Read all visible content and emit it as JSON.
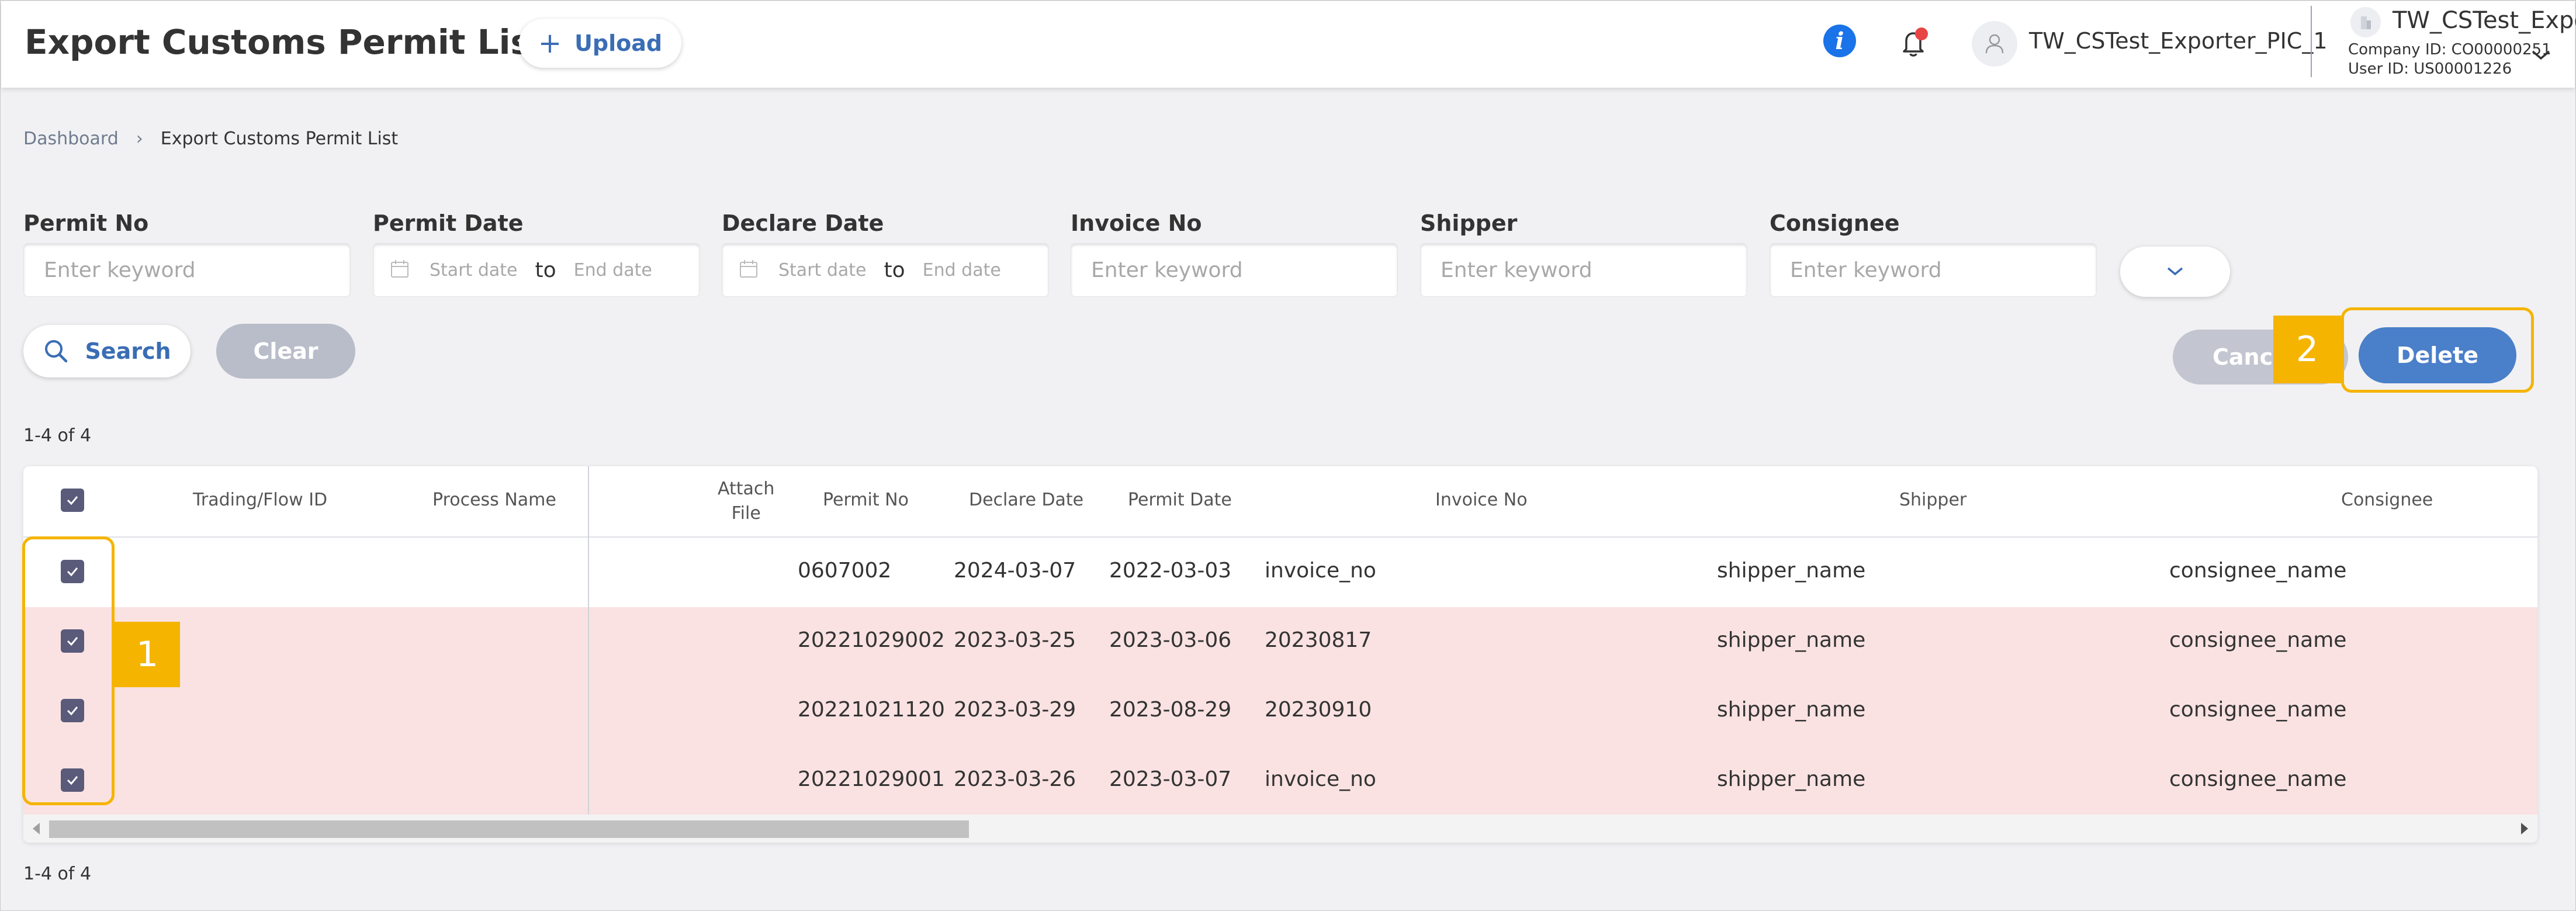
{
  "header": {
    "title": "Export Customs Permit List",
    "upload_label": "Upload",
    "user_name": "TW_CSTest_Exporter_PIC_1",
    "company_name": "TW_CSTest_Expo...",
    "company_id": "Company ID: CO00000251",
    "user_id": "User ID: US00001226"
  },
  "breadcrumb": {
    "home": "Dashboard",
    "separator": "›",
    "current": "Export Customs Permit List"
  },
  "filters": {
    "permit_no": {
      "label": "Permit No",
      "placeholder": "Enter keyword"
    },
    "permit_date": {
      "label": "Permit Date",
      "start": "Start date",
      "to": "to",
      "end": "End date"
    },
    "declare_date": {
      "label": "Declare Date",
      "start": "Start date",
      "to": "to",
      "end": "End date"
    },
    "invoice_no": {
      "label": "Invoice No",
      "placeholder": "Enter keyword"
    },
    "shipper": {
      "label": "Shipper",
      "placeholder": "Enter keyword"
    },
    "consignee": {
      "label": "Consignee",
      "placeholder": "Enter keyword"
    }
  },
  "actions": {
    "search": "Search",
    "clear": "Clear",
    "cancel": "Cancel",
    "delete": "Delete"
  },
  "count_top": "1-4 of 4",
  "count_bottom": "1-4 of 4",
  "table": {
    "headers": {
      "trading_flow_id": "Trading/Flow ID",
      "process_name": "Process Name",
      "attach_file_1": "Attach",
      "attach_file_2": "File",
      "permit_no": "Permit No",
      "declare_date": "Declare Date",
      "permit_date": "Permit Date",
      "invoice_no": "Invoice No",
      "shipper": "Shipper",
      "consignee": "Consignee"
    },
    "rows": [
      {
        "permit_no": "0607002",
        "declare_date": "2024-03-07",
        "permit_date": "2022-03-03",
        "invoice_no": "invoice_no",
        "shipper": "shipper_name",
        "consignee": "consignee_name",
        "checked": true
      },
      {
        "permit_no": "20221029002",
        "declare_date": "2023-03-25",
        "permit_date": "2023-03-06",
        "invoice_no": "20230817",
        "shipper": "shipper_name",
        "consignee": "consignee_name",
        "checked": true
      },
      {
        "permit_no": "20221021120",
        "declare_date": "2023-03-29",
        "permit_date": "2023-08-29",
        "invoice_no": "20230910",
        "shipper": "shipper_name",
        "consignee": "consignee_name",
        "checked": true
      },
      {
        "permit_no": "20221029001",
        "declare_date": "2023-03-26",
        "permit_date": "2023-03-07",
        "invoice_no": "invoice_no",
        "shipper": "shipper_name",
        "consignee": "consignee_name",
        "checked": true
      }
    ]
  },
  "markers": {
    "one": "1",
    "two": "2"
  },
  "colors": {
    "accent": "#4a7fc9",
    "highlight": "#f5b400",
    "selected_row": "#fae2e2",
    "notification": "#e84545"
  }
}
